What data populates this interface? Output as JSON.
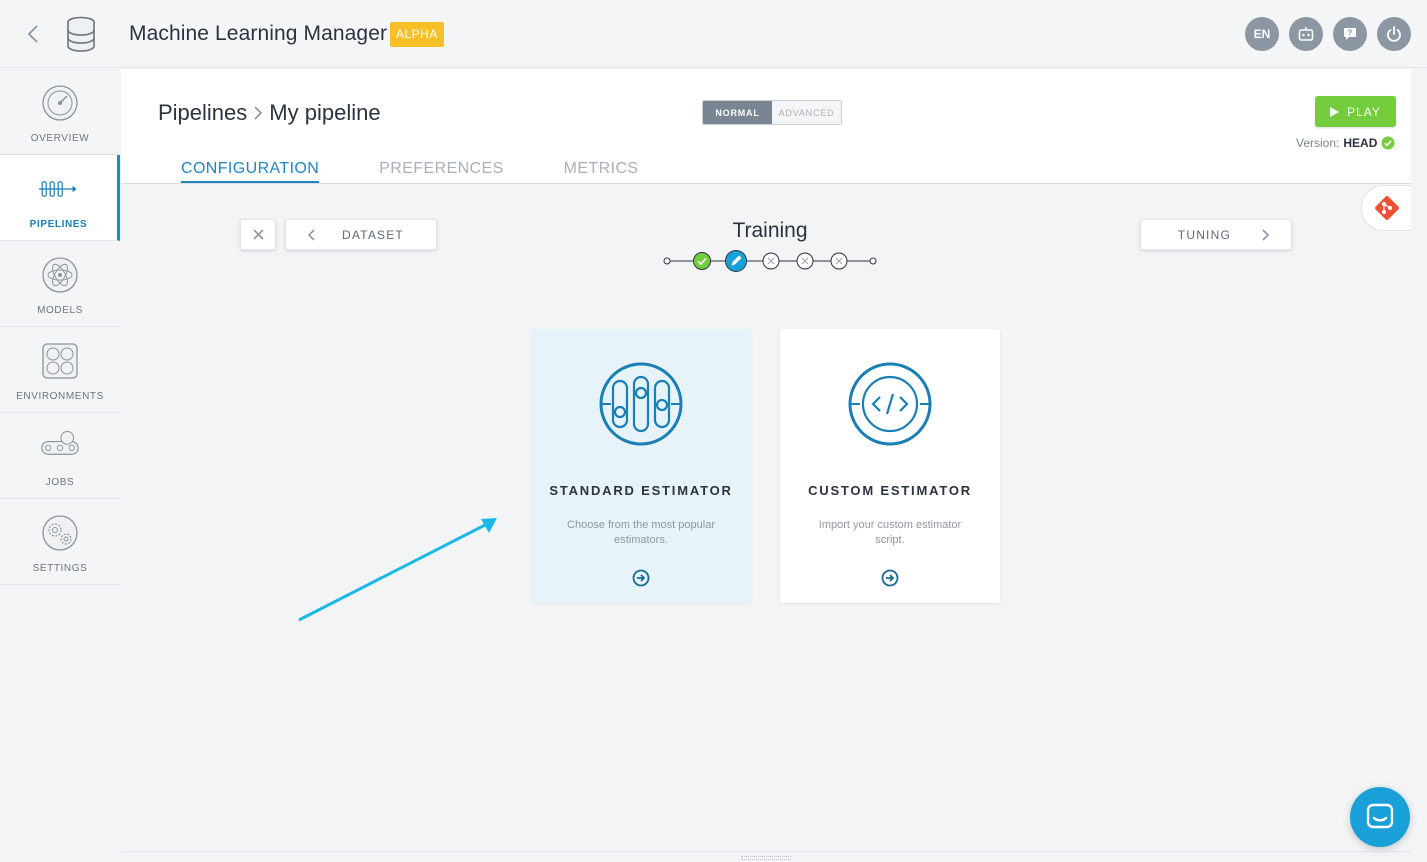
{
  "topbar": {
    "title": "Machine Learning Manager",
    "badge": "ALPHA",
    "language": "EN"
  },
  "sidebar": {
    "items": [
      {
        "label": "OVERVIEW",
        "icon": "gauge-icon"
      },
      {
        "label": "PIPELINES",
        "icon": "pipeline-icon",
        "active": true
      },
      {
        "label": "MODELS",
        "icon": "atom-icon"
      },
      {
        "label": "ENVIRONMENTS",
        "icon": "cube-icon"
      },
      {
        "label": "JOBS",
        "icon": "conveyor-icon"
      },
      {
        "label": "SETTINGS",
        "icon": "gears-icon"
      }
    ]
  },
  "header": {
    "breadcrumb": {
      "root": "Pipelines",
      "current": "My pipeline"
    },
    "mode": {
      "normal": "NORMAL",
      "advanced": "ADVANCED",
      "selected": "normal"
    },
    "play_label": "PLAY",
    "version_label": "Version:",
    "version_value": "HEAD",
    "tabs": [
      {
        "label": "CONFIGURATION",
        "active": true
      },
      {
        "label": "PREFERENCES"
      },
      {
        "label": "METRICS"
      }
    ]
  },
  "wizard": {
    "prev_label": "DATASET",
    "next_label": "TUNING",
    "step_title": "Training",
    "steps": [
      "done",
      "current",
      "pending",
      "pending",
      "pending"
    ]
  },
  "cards": [
    {
      "title": "STANDARD ESTIMATOR",
      "description": "Choose from the most popular estimators."
    },
    {
      "title": "CUSTOM ESTIMATOR",
      "description": "Import your custom estimator script."
    }
  ],
  "colors": {
    "accent": "#1e86bf",
    "play": "#74cd3c",
    "badge": "#f6c026",
    "annotation": "#1ab8e8"
  }
}
